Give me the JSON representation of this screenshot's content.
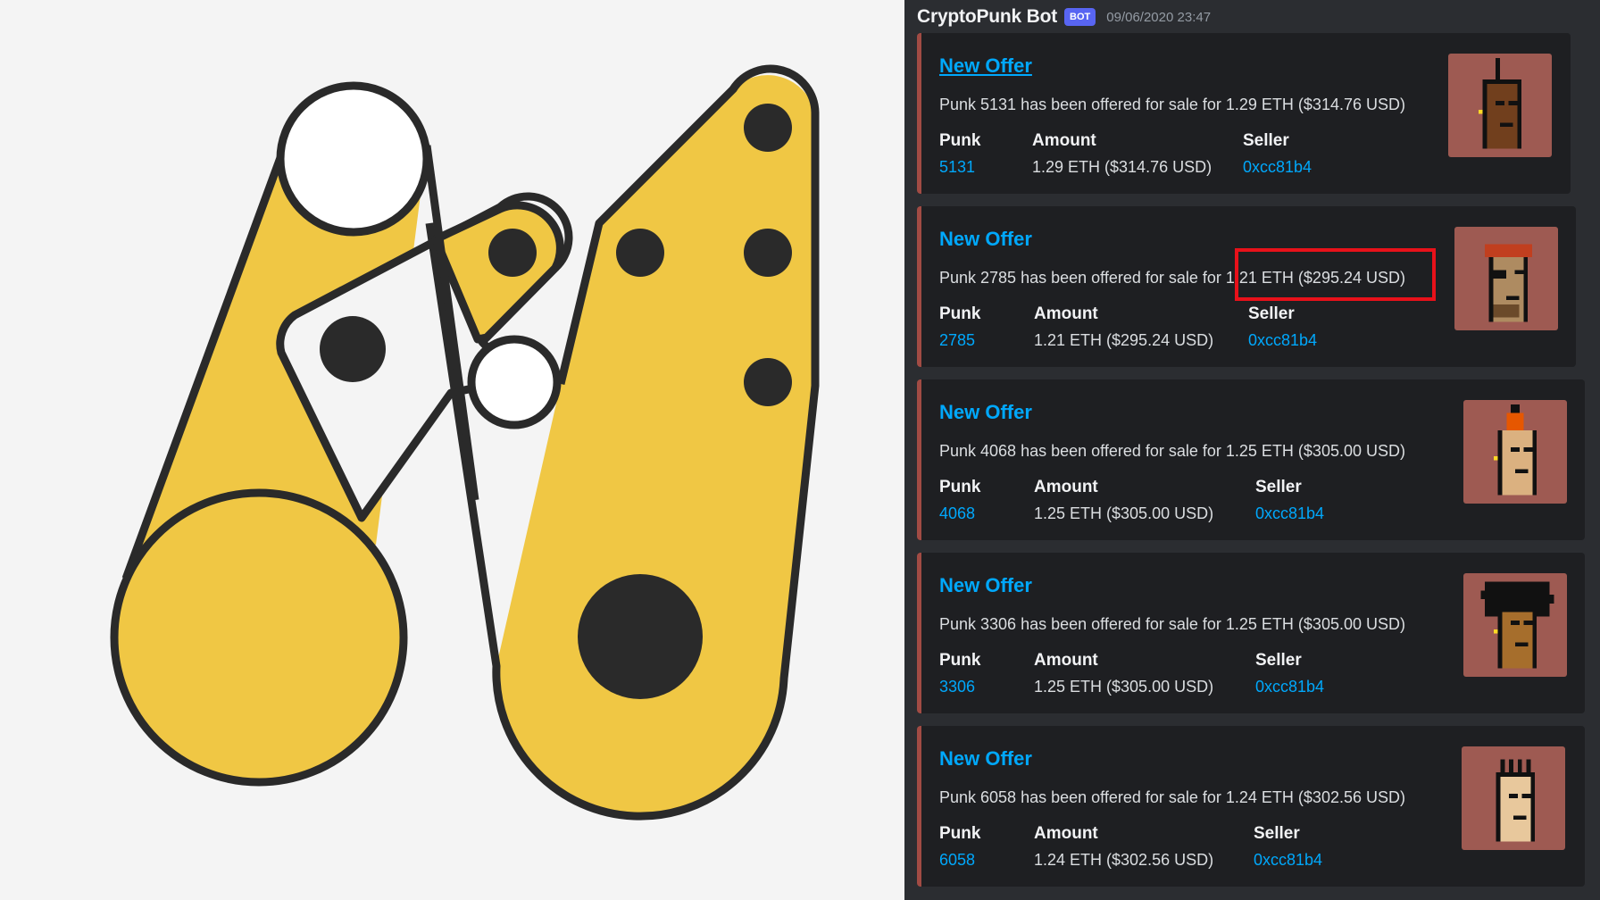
{
  "message": {
    "bot_name": "CryptoPunk Bot",
    "badge": "BOT",
    "timestamp": "09/06/2020 23:47"
  },
  "field_labels": {
    "punk": "Punk",
    "amount": "Amount",
    "seller": "Seller"
  },
  "offers": [
    {
      "title": "New Offer",
      "description": "Punk 5131 has been offered for sale for 1.29 ETH ($314.76 USD)",
      "punk": "5131",
      "amount": "1.29 ETH ($314.76 USD)",
      "seller": "0xcc81b4"
    },
    {
      "title": "New Offer",
      "description": "Punk 2785 has been offered for sale for 1.21 ETH ($295.24 USD)",
      "punk": "2785",
      "amount": "1.21 ETH ($295.24 USD)",
      "seller": "0xcc81b4"
    },
    {
      "title": "New Offer",
      "description": "Punk 4068 has been offered for sale for 1.25 ETH ($305.00 USD)",
      "punk": "4068",
      "amount": "1.25 ETH ($305.00 USD)",
      "seller": "0xcc81b4"
    },
    {
      "title": "New Offer",
      "description": "Punk 3306 has been offered for sale for 1.25 ETH ($305.00 USD)",
      "punk": "3306",
      "amount": "1.25 ETH ($305.00 USD)",
      "seller": "0xcc81b4"
    },
    {
      "title": "New Offer",
      "description": "Punk 6058 has been offered for sale for 1.24 ETH ($302.56 USD)",
      "punk": "6058",
      "amount": "1.24 ETH ($302.56 USD)",
      "seller": "0xcc81b4"
    }
  ],
  "colors": {
    "logo_yellow": "#f0c744",
    "logo_outline": "#2a2a2a",
    "embed_bar": "#a14b44",
    "link": "#00a8fc",
    "highlight": "#e8111a"
  },
  "icons": {
    "logo": "yellow-machine-logo",
    "thumbnail": "cryptopunk-avatar-icon"
  }
}
